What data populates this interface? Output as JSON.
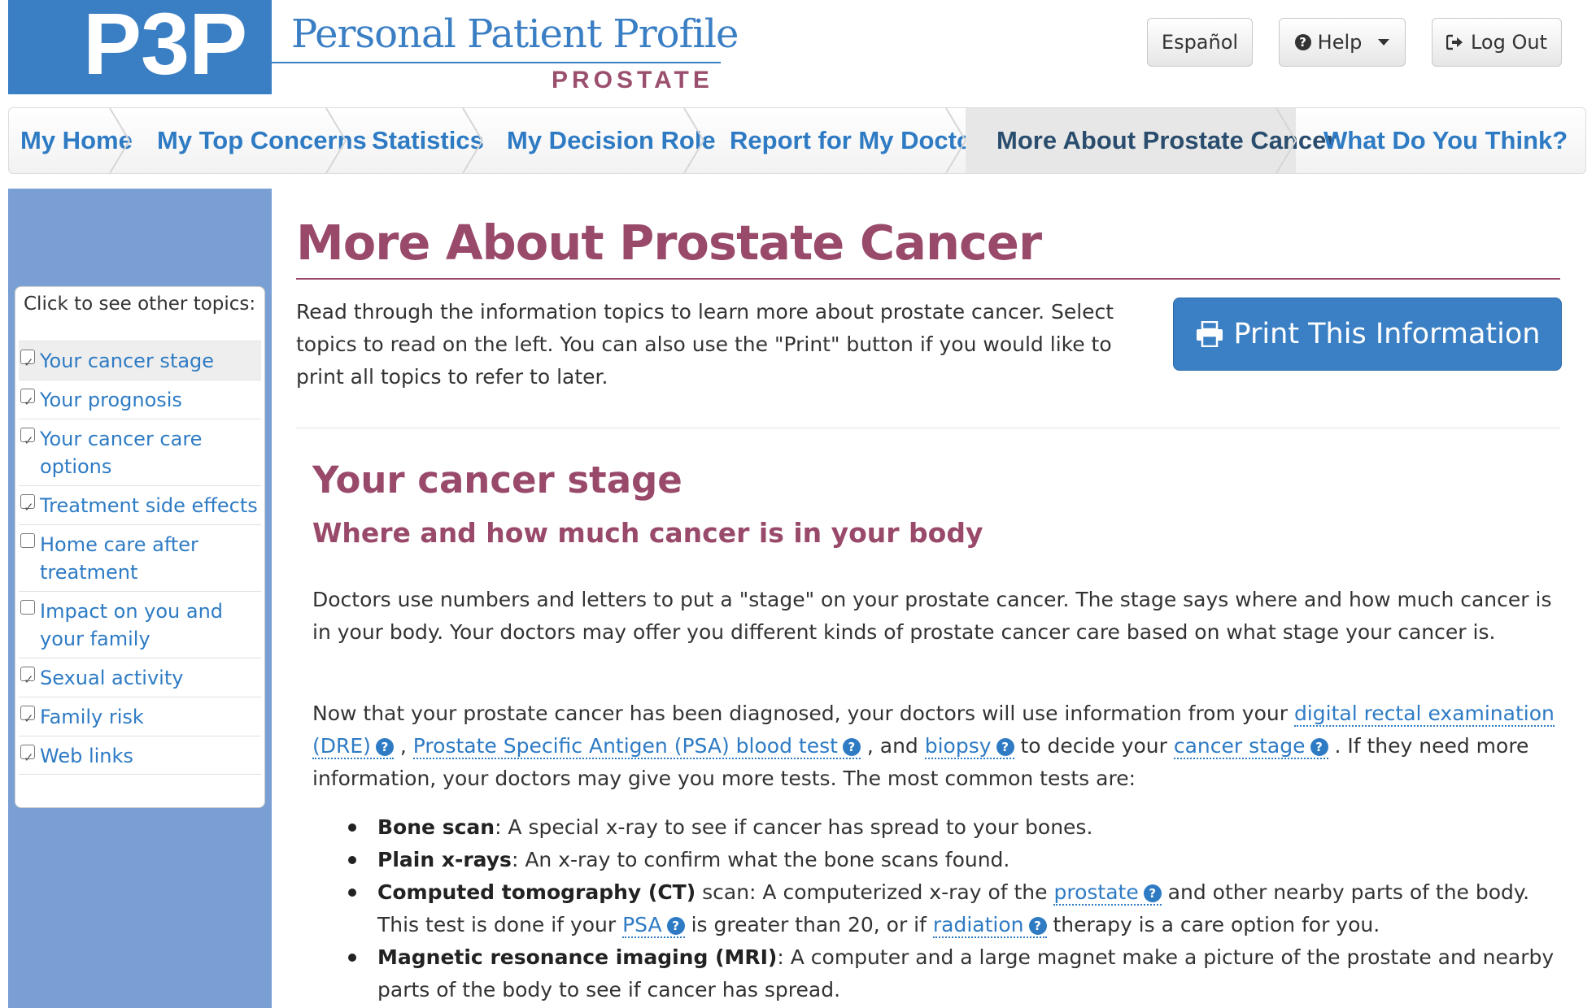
{
  "header": {
    "logo_text": "P3P",
    "brand_title": "Personal Patient Profile",
    "brand_subtitle": "PROSTATE",
    "language_button": "Español",
    "help_button": "Help",
    "logout_button": "Log Out"
  },
  "nav": {
    "items": [
      {
        "label": "My Home"
      },
      {
        "label": "My Top Concerns"
      },
      {
        "label": "Statistics"
      },
      {
        "label": "My Decision Role"
      },
      {
        "label": "Report for My Doctor"
      },
      {
        "label": "More About Prostate Cancer",
        "active": true
      },
      {
        "label": "What Do You Think?"
      }
    ]
  },
  "sidebar": {
    "heading": "Click to see other topics:",
    "topics": [
      {
        "line1": "Your cancer stage",
        "line2": "",
        "checked": true,
        "selected": true
      },
      {
        "line1": "Your prognosis",
        "line2": "",
        "checked": true
      },
      {
        "line1": "Your cancer care",
        "line2": "options",
        "checked": true
      },
      {
        "line1": "Treatment side effects",
        "line2": "",
        "checked": true
      },
      {
        "line1": "Home care after",
        "line2": "treatment",
        "checked": false
      },
      {
        "line1": "Impact on you and",
        "line2": "your family",
        "checked": false
      },
      {
        "line1": "Sexual activity",
        "line2": "",
        "checked": true
      },
      {
        "line1": "Family risk",
        "line2": "",
        "checked": true
      },
      {
        "line1": "Web links",
        "line2": "",
        "checked": true
      }
    ]
  },
  "main": {
    "title": "More About Prostate Cancer",
    "intro": "Read through the information topics to learn more about prostate cancer. Select topics to read on the left. You can also use the \"Print\" button if you would like to print all topics to refer to later.",
    "print_button": "Print This Information",
    "section": {
      "title": "Your cancer stage",
      "subtitle": "Where and how much cancer is in your body",
      "para1": "Doctors use numbers and letters to put a \"stage\" on your prostate cancer. The stage says where and how much cancer is in your body. Your doctors may offer you different kinds of prostate cancer care based on what stage your cancer is.",
      "para2": {
        "t1": "Now that your prostate cancer has been diagnosed, your doctors will use information from your ",
        "link_dre": "digital rectal examination (DRE)",
        "t2": " , ",
        "link_psa_test": "Prostate Specific Antigen (PSA) blood test",
        "t3": " , and ",
        "link_biopsy": "biopsy",
        "t4": "  to decide your ",
        "link_stage": "cancer stage",
        "t5": " . If they need more information, your doctors may give you more tests. The most common tests are:"
      },
      "bullets": {
        "bone_b": "Bone scan",
        "bone_t": ": A special x-ray to see if cancer has spread to your bones.",
        "plain_b": "Plain x-rays",
        "plain_t": ": An x-ray to confirm what the bone scans found.",
        "ct_b": "Computed tomography (CT)",
        "ct_t1": " scan: A computerized x-ray of the ",
        "ct_link_prostate": "prostate",
        "ct_t2": "  and other nearby parts of the body. This test is done if your ",
        "ct_link_psa": "PSA",
        "ct_t3": "  is greater than 20, or if ",
        "ct_link_radiation": "radiation",
        "ct_t4": "  therapy is a care option for you.",
        "mri_b": "Magnetic resonance imaging (MRI)",
        "mri_t": ": A computer and a large magnet make a picture of the prostate and nearby parts of the body to see if cancer has spread."
      }
    }
  },
  "colors": {
    "brand_blue": "#3a7ec4",
    "accent_plum": "#99496a",
    "link_blue": "#2e7bc4",
    "sidebar_blue": "#7a9fd4"
  }
}
